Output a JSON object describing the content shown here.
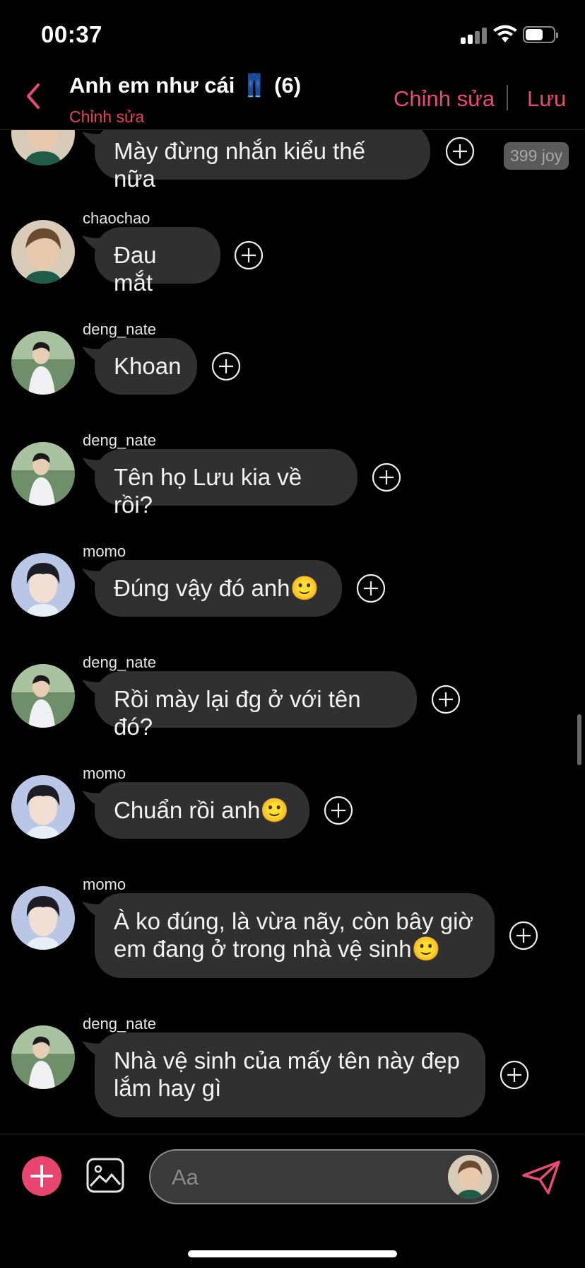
{
  "status_bar": {
    "time": "00:37"
  },
  "header": {
    "title": "Anh em như cái 👖 (6)",
    "subtitle": "Chỉnh sửa",
    "edit_label": "Chỉnh sửa",
    "save_label": "Lưu",
    "accent_color": "#e94a73"
  },
  "reaction_badge": "399 joy",
  "messages": [
    {
      "sender": "",
      "text": "Mày đừng nhắn kiểu thế nữa",
      "avatar": "chaochao-avatar"
    },
    {
      "sender": "chaochao",
      "text": "Đau mắt",
      "avatar": "chaochao-avatar"
    },
    {
      "sender": "deng_nate",
      "text": "Khoan",
      "avatar": "deng-nate-avatar"
    },
    {
      "sender": "deng_nate",
      "text": "Tên họ Lưu kia về rồi?",
      "avatar": "deng-nate-avatar"
    },
    {
      "sender": "momo",
      "text": "Đúng vậy đó anh🙂",
      "avatar": "momo-avatar"
    },
    {
      "sender": "deng_nate",
      "text": "Rồi mày lại đg ở với tên đó?",
      "avatar": "deng-nate-avatar"
    },
    {
      "sender": "momo",
      "text": "Chuẩn rồi anh🙂",
      "avatar": "momo-avatar"
    },
    {
      "sender": "momo",
      "text": "À ko đúng, là vừa nãy, còn bây giờ\nem đang ở trong nhà vệ sinh🙂",
      "avatar": "momo-avatar"
    },
    {
      "sender": "deng_nate",
      "text": "Nhà vệ sinh của mấy tên này đẹp\nlắm hay gì",
      "avatar": "deng-nate-avatar"
    }
  ],
  "composer": {
    "placeholder": "Aa"
  }
}
